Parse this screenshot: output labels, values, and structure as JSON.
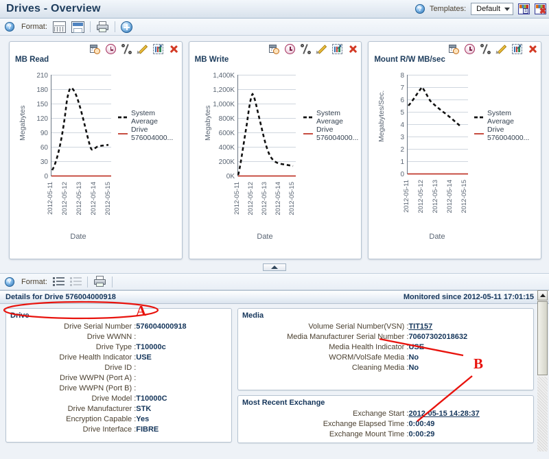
{
  "window": {
    "title": "Drives - Overview"
  },
  "header": {
    "help_icon": "help-icon",
    "templates_label": "Templates:",
    "template_selected": "Default",
    "save_template_icon": "save-template-icon",
    "delete_template_icon": "delete-template-icon"
  },
  "top_toolbar": {
    "help_icon": "help-icon",
    "format_label": "Format:",
    "grid_view_icon": "grid-view-icon",
    "split_view_icon": "split-view-icon",
    "print_icon": "print-icon",
    "add_icon": "add-graph-icon"
  },
  "chart_toolbar_icons": [
    "schedule-icon",
    "clock-icon",
    "percent-icon",
    "edit-icon",
    "expand-chart-icon",
    "close-icon"
  ],
  "chart_data": [
    {
      "type": "line",
      "title": "MB Read",
      "xlabel": "Date",
      "ylabel": "Megabytes",
      "categories": [
        "2012-05-11",
        "2012-05-12",
        "2012-05-13",
        "2012-05-14",
        "2012-05-15"
      ],
      "yticks": [
        0,
        30,
        60,
        90,
        120,
        150,
        180,
        210
      ],
      "ylim": [
        0,
        210
      ],
      "grid": true,
      "legend_position": "right",
      "series": [
        {
          "name": "System Average",
          "style": "dashed",
          "color": "#111111",
          "values": [
            12,
            172,
            135,
            62,
            67
          ]
        },
        {
          "name": "Drive 576004000...",
          "style": "solid",
          "color": "#c0392b",
          "values": [
            0,
            0,
            0,
            0,
            0
          ]
        }
      ]
    },
    {
      "type": "line",
      "title": "MB Write",
      "xlabel": "Date",
      "ylabel": "Megabytes",
      "categories": [
        "2012-05-11",
        "2012-05-12",
        "2012-05-13",
        "2012-05-14",
        "2012-05-15"
      ],
      "yticks": [
        "0K",
        "200K",
        "400K",
        "600K",
        "800K",
        "1,000K",
        "1,200K",
        "1,400K"
      ],
      "ylim": [
        0,
        1400000
      ],
      "grid": true,
      "legend_position": "right",
      "series": [
        {
          "name": "System Average",
          "style": "dashed",
          "color": "#111111",
          "values": [
            20000,
            1140000,
            620000,
            230000,
            205000
          ]
        },
        {
          "name": "Drive 576004000...",
          "style": "solid",
          "color": "#c0392b",
          "values": [
            0,
            0,
            0,
            0,
            0
          ]
        }
      ]
    },
    {
      "type": "line",
      "title": "Mount R/W MB/sec",
      "xlabel": "Date",
      "ylabel": "Megabytes/Sec.",
      "categories": [
        "2012-05-11",
        "2012-05-12",
        "2012-05-13",
        "2012-05-14",
        "2012-05-15"
      ],
      "yticks": [
        0,
        1,
        2,
        3,
        4,
        5,
        6,
        7,
        8
      ],
      "ylim": [
        0,
        8
      ],
      "grid": true,
      "legend_position": "right",
      "series": [
        {
          "name": "System Average",
          "style": "dashed",
          "color": "#111111",
          "values": [
            5.5,
            7.0,
            6.0,
            5.2,
            4.4
          ]
        },
        {
          "name": "Drive 576004000...",
          "style": "solid",
          "color": "#c0392b",
          "values": [
            0,
            0,
            0,
            0,
            0
          ]
        }
      ]
    }
  ],
  "splitter": {
    "collapse_icon": "collapse-arrow-icon"
  },
  "bottom_toolbar": {
    "help_icon": "help-icon",
    "format_label": "Format:",
    "list_view_icon": "list-view-icon",
    "detail_view_icon": "detail-view-icon",
    "print_icon": "print-icon"
  },
  "details": {
    "title": "Details for Drive 576004000918",
    "monitored_since": "Monitored since 2012-05-11 17:01:15",
    "drive_panel": {
      "title": "Drive",
      "rows": [
        {
          "label": "Drive Serial Number :",
          "value": "576004000918"
        },
        {
          "label": "Drive WWNN :",
          "value": ""
        },
        {
          "label": "Drive Type :",
          "value": "T10000c"
        },
        {
          "label": "Drive Health Indicator :",
          "value": "USE"
        },
        {
          "label": "Drive ID :",
          "value": ""
        },
        {
          "label": "Drive WWPN (Port A) :",
          "value": ""
        },
        {
          "label": "Drive WWPN (Port B) :",
          "value": ""
        },
        {
          "label": "Drive Model :",
          "value": "T10000C"
        },
        {
          "label": "Drive Manufacturer :",
          "value": "STK"
        },
        {
          "label": "Encryption Capable :",
          "value": "Yes"
        },
        {
          "label": "Drive Interface :",
          "value": "FIBRE"
        }
      ]
    },
    "media_panel": {
      "title": "Media",
      "rows": [
        {
          "label": "Volume Serial Number(VSN) :",
          "value": "TIT157",
          "link": true
        },
        {
          "label": "Media Manufacturer Serial Number :",
          "value": "70607302018632"
        },
        {
          "label": "Media Health Indicator :",
          "value": "USE"
        },
        {
          "label": "WORM/VolSafe Media :",
          "value": "No"
        },
        {
          "label": "Cleaning Media :",
          "value": "No"
        }
      ]
    },
    "exchange_panel": {
      "title": "Most Recent Exchange",
      "rows": [
        {
          "label": "Exchange Start :",
          "value": "2012-05-15 14:28:37",
          "link": true
        },
        {
          "label": "Exchange Elapsed Time :",
          "value": "0:00:49"
        },
        {
          "label": "Exchange Mount Time :",
          "value": "0:00:29"
        }
      ]
    }
  },
  "annotations": [
    {
      "letter": "A"
    },
    {
      "letter": "B"
    }
  ],
  "colors": {
    "title_blue": "#1d3c5c",
    "annotation_red": "#e8130d",
    "series_drive": "#c0392b"
  }
}
